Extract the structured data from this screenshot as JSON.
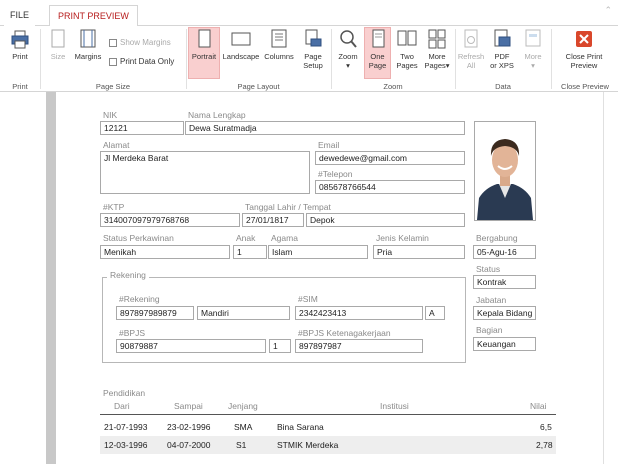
{
  "tabs": {
    "file": "FILE",
    "print_preview": "PRINT PREVIEW"
  },
  "ribbon": {
    "print": {
      "label": "Print",
      "group": "Print"
    },
    "page_size": {
      "group": "Page Size",
      "size": "Size",
      "margins": "Margins",
      "show_margins": "Show Margins",
      "print_data_only": "Print Data Only"
    },
    "page_layout": {
      "group": "Page Layout",
      "portrait": "Portrait",
      "landscape": "Landscape",
      "columns": "Columns",
      "page_setup_1": "Page",
      "page_setup_2": "Setup"
    },
    "zoom": {
      "group": "Zoom",
      "zoom": "Zoom",
      "one_page_1": "One",
      "one_page_2": "Page",
      "two_pages_1": "Two",
      "two_pages_2": "Pages",
      "more_pages_1": "More",
      "more_pages_2": "Pages"
    },
    "data": {
      "group": "Data",
      "refresh_1": "Refresh",
      "refresh_2": "All",
      "pdf_1": "PDF",
      "pdf_2": "or XPS",
      "more": "More"
    },
    "close": {
      "group": "Close Preview",
      "close_1": "Close Print",
      "close_2": "Preview"
    }
  },
  "form": {
    "nik_label": "NIK",
    "nik": "12121",
    "nama_label": "Nama Lengkap",
    "nama": "Dewa Suratmadja",
    "alamat_label": "Alamat",
    "alamat": "Jl Merdeka Barat",
    "email_label": "Email",
    "email": "dewedewe@gmail.com",
    "telepon_label": "#Telepon",
    "telepon": "085678766544",
    "ktp_label": "#KTP",
    "ktp": "314007097979768768",
    "ttl_label": "Tanggal Lahir / Tempat",
    "tgl_lahir": "27/01/1817",
    "tempat": "Depok",
    "status_kawin_label": "Status Perkawinan",
    "status_kawin": "Menikah",
    "anak_label": "Anak",
    "anak": "1",
    "agama_label": "Agama",
    "agama": "Islam",
    "jk_label": "Jenis Kelamin",
    "jk": "Pria",
    "bergabung_label": "Bergabung",
    "bergabung": "05-Agu-16",
    "status_label": "Status",
    "status": "Kontrak",
    "jabatan_label": "Jabatan",
    "jabatan": "Kepala Bidang",
    "bagian_label": "Bagian",
    "bagian": "Keuangan",
    "rekening_title": "Rekening",
    "rekening_label": "#Rekening",
    "rekening": "897897989879",
    "bank": "Mandiri",
    "sim_label": "#SIM",
    "sim": "2342423413",
    "sim_type": "A",
    "bpjs_label": "#BPJS",
    "bpjs": "90879887",
    "bpjs_num": "1",
    "bpjs_tk_label": "#BPJS Ketenagakerjaan",
    "bpjs_tk": "897897987"
  },
  "pendidikan": {
    "title": "Pendidikan",
    "headers": {
      "dari": "Dari",
      "sampai": "Sampai",
      "jenjang": "Jenjang",
      "institusi": "Institusi",
      "nilai": "Nilai"
    },
    "rows": [
      {
        "dari": "21-07-1993",
        "sampai": "23-02-1996",
        "jenjang": "SMA",
        "institusi": "Bina Sarana",
        "nilai": "6,5"
      },
      {
        "dari": "12-03-1996",
        "sampai": "04-07-2000",
        "jenjang": "S1",
        "institusi": "STMIK Merdeka",
        "nilai": "2,78"
      }
    ]
  },
  "colors": {
    "accent": "#b71c1c",
    "active_button": "#f9cfcf",
    "close_icon": "#d9472b"
  }
}
